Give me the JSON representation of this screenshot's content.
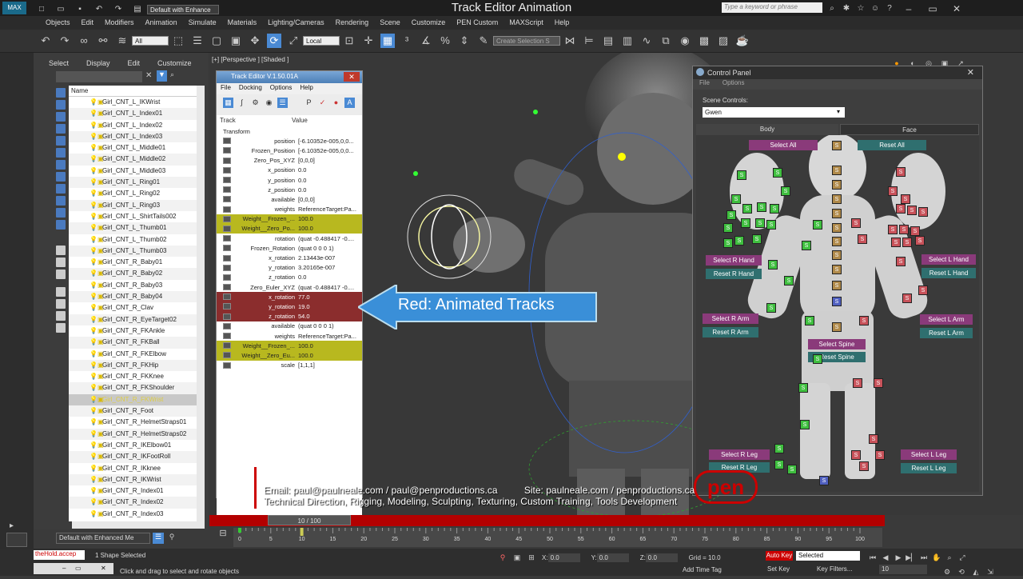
{
  "app": {
    "title": "Track Editor Animation",
    "workspace": "Default with Enhance",
    "search_placeholder": "Type a keyword or phrase"
  },
  "menu": [
    "Objects",
    "Edit",
    "Modifiers",
    "Animation",
    "Simulate",
    "Materials",
    "Lighting/Cameras",
    "Rendering",
    "Scene",
    "Customize",
    "PEN Custom",
    "MAXScript",
    "Help"
  ],
  "toolbar": {
    "filter_value": "All",
    "coord_value": "Local",
    "selection_set_placeholder": "Create Selection S"
  },
  "scene_explorer": {
    "menu": [
      "Select",
      "Display",
      "Edit",
      "Customize"
    ],
    "column": "Name",
    "items": [
      "Girl_CNT_L_IKWrist",
      "Girl_CNT_L_Index01",
      "Girl_CNT_L_Index02",
      "Girl_CNT_L_Index03",
      "Girl_CNT_L_Middle01",
      "Girl_CNT_L_Middle02",
      "Girl_CNT_L_Middle03",
      "Girl_CNT_L_Ring01",
      "Girl_CNT_L_Ring02",
      "Girl_CNT_L_Ring03",
      "Girl_CNT_L_ShirtTails002",
      "Girl_CNT_L_Thumb01",
      "Girl_CNT_L_Thumb02",
      "Girl_CNT_L_Thumb03",
      "Girl_CNT_R_Baby01",
      "Girl_CNT_R_Baby02",
      "Girl_CNT_R_Baby03",
      "Girl_CNT_R_Baby04",
      "Girl_CNT_R_Clav",
      "Girl_CNT_R_EyeTarget02",
      "Girl_CNT_R_FKAnkle",
      "Girl_CNT_R_FKBall",
      "Girl_CNT_R_FKElbow",
      "Girl_CNT_R_FKHip",
      "Girl_CNT_R_FKKnee",
      "Girl_CNT_R_FKShoulder",
      "Girl_CNT_R_FKWrist",
      "Girl_CNT_R_Foot",
      "Girl_CNT_R_HelmetStraps01",
      "Girl_CNT_R_HelmetStraps02",
      "Girl_CNT_R_IKElbow01",
      "Girl_CNT_R_IKFootRoll",
      "Girl_CNT_R_IKknee",
      "Girl_CNT_R_IKWrist",
      "Girl_CNT_R_Index01",
      "Girl_CNT_R_Index02",
      "Girl_CNT_R_Index03"
    ],
    "selected_index": 26,
    "workspace_footer": "Default with Enhanced Me"
  },
  "viewport": {
    "label": "[+] [Perspective ] [Shaded ]"
  },
  "track_editor": {
    "title": "Track Editor V.1.50.01A",
    "menu": [
      "File",
      "Docking",
      "Options",
      "Help"
    ],
    "col_track": "Track",
    "col_value": "Value",
    "root": "Transform",
    "rows": [
      {
        "k": "position",
        "v": "[-6.10352e-005,0,0..."
      },
      {
        "k": "Frozen_Position",
        "v": "[-6.10352e-005,0,0..."
      },
      {
        "k": "Zero_Pos_XYZ",
        "v": "[0,0,0]"
      },
      {
        "k": "x_position",
        "v": "0.0"
      },
      {
        "k": "y_position",
        "v": "0.0"
      },
      {
        "k": "z_position",
        "v": "0.0"
      },
      {
        "k": "available",
        "v": "[0,0,0]"
      },
      {
        "k": "weights",
        "v": "ReferenceTarget:Pa..."
      },
      {
        "k": "Weight__Frozen_...",
        "v": "100.0",
        "c": "yel"
      },
      {
        "k": "Weight__Zero_Po...",
        "v": "100.0",
        "c": "yel"
      },
      {
        "k": "rotation",
        "v": "(quat -0.488417 -0...."
      },
      {
        "k": "Frozen_Rotation",
        "v": "(quat 0 0 0 1)"
      },
      {
        "k": "x_rotation",
        "v": "2.13443e-007"
      },
      {
        "k": "y_rotation",
        "v": "3.20165e-007"
      },
      {
        "k": "z_rotation",
        "v": "0.0"
      },
      {
        "k": "Zero_Euler_XYZ",
        "v": "(quat -0.488417 -0...."
      },
      {
        "k": "x_rotation",
        "v": "77.0",
        "c": "red"
      },
      {
        "k": "y_rotation",
        "v": "19.0",
        "c": "red"
      },
      {
        "k": "z_rotation",
        "v": "54.0",
        "c": "red"
      },
      {
        "k": "available",
        "v": "(quat 0 0 0 1)"
      },
      {
        "k": "weights",
        "v": "ReferenceTarget:Pa..."
      },
      {
        "k": "Weight__Frozen_...",
        "v": "100.0",
        "c": "yel"
      },
      {
        "k": "Weight__Zero_Eu...",
        "v": "100.0",
        "c": "yel"
      },
      {
        "k": "scale",
        "v": "[1,1,1]"
      }
    ]
  },
  "callout": "Red: Animated Tracks",
  "control_panel": {
    "title": "Control Panel",
    "menu": [
      "File",
      "Options"
    ],
    "scene_controls_label": "Scene Controls:",
    "scene_value": "Gwen",
    "tabs": [
      "Body",
      "Face"
    ],
    "buttons": {
      "select_all": "Select All",
      "reset_all": "Reset All",
      "select_r_hand": "Select R Hand",
      "reset_r_hand": "Reset R Hand",
      "select_l_hand": "Select L Hand",
      "reset_l_hand": "Reset L Hand",
      "select_r_arm": "Select R Arm",
      "reset_r_arm": "Reset R Arm",
      "select_l_arm": "Select L Arm",
      "reset_l_arm": "Reset L Arm",
      "select_spine": "Select Spine",
      "reset_spine": "Reset Spine",
      "select_r_leg": "Select R Leg",
      "reset_r_leg": "Reset R Leg",
      "select_l_leg": "Select L Leg",
      "reset_l_leg": "Reset L Leg"
    },
    "square_label": "S"
  },
  "contact": {
    "line1": "Email: paul@paulneale.com / paul@penproductions.ca          Site: paulneale.com / penproductions.ca",
    "line2": "Technical Direction, Rigging, Modeling, Sculpting, Texturing, Custom Training, Tools Development",
    "logo": "pen"
  },
  "timeline": {
    "frame": "10 / 100",
    "ticks": [
      "0",
      "5",
      "10",
      "15",
      "20",
      "25",
      "30",
      "35",
      "40",
      "45",
      "50",
      "55",
      "60",
      "65",
      "70",
      "75",
      "80",
      "85",
      "90",
      "95",
      "100"
    ],
    "current_frame": 10
  },
  "status": {
    "listener": "theHold.accep",
    "selection": "1 Shape Selected",
    "prompt": "Click and drag to select and rotate objects",
    "x": "0.0",
    "y": "0.0",
    "z": "0.0",
    "grid": "Grid = 10.0",
    "auto_key": "Auto Key",
    "set_key": "Set Key",
    "key_mode": "Selected",
    "key_filters": "Key Filters...",
    "add_time_tag": "Add Time Tag",
    "frame": "10"
  },
  "colors": {
    "accent": "#4c7fb7",
    "timeline": "#b30000",
    "animated": "#8b2d2d",
    "weights": "#b8b81f"
  }
}
